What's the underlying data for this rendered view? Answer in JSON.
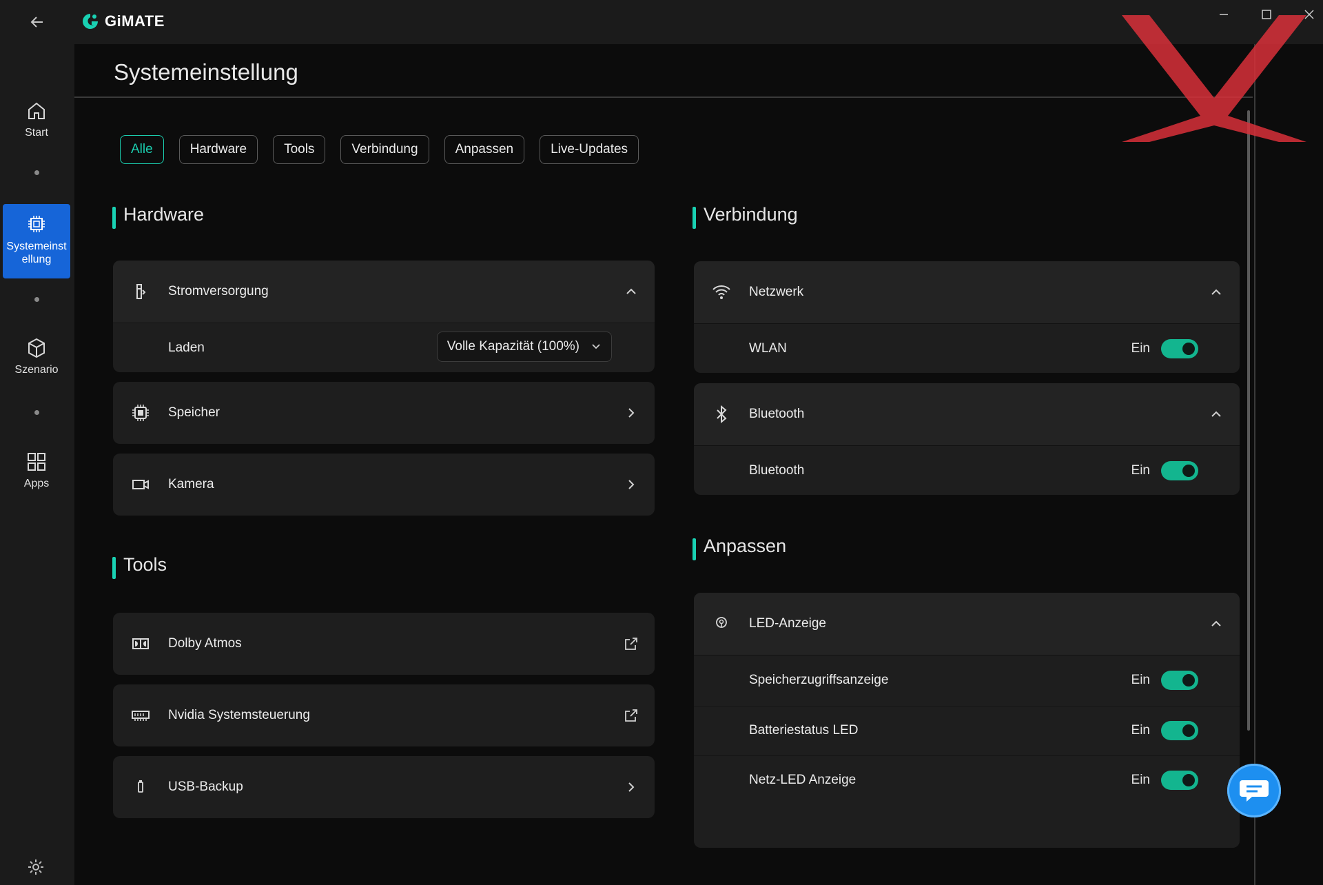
{
  "app": {
    "name": "GiMATE",
    "window_controls": [
      "minimize",
      "maximize",
      "close"
    ]
  },
  "colors": {
    "accent": "#19d1b3",
    "toggle_on": "#13b58f",
    "nav_active": "#1665d8",
    "watermark": "#e0303a"
  },
  "sidebar": {
    "items": [
      {
        "label": "Start",
        "icon": "home-icon"
      },
      {
        "label": "Systemeinst ellung",
        "icon": "chip-icon",
        "active": true
      },
      {
        "label": "Szenario",
        "icon": "cube-icon"
      },
      {
        "label": "Apps",
        "icon": "grid-icon"
      }
    ],
    "settings_icon": "gear-icon"
  },
  "page": {
    "title": "Systemeinstellung",
    "filters": [
      "Alle",
      "Hardware",
      "Tools",
      "Verbindung",
      "Anpassen",
      "Live-Updates"
    ],
    "active_filter": "Alle"
  },
  "hardware": {
    "title": "Hardware",
    "power": {
      "label": "Stromversorgung",
      "row_label": "Laden",
      "select_value": "Volle Kapazität (100%)"
    },
    "storage": {
      "label": "Speicher"
    },
    "camera": {
      "label": "Kamera"
    }
  },
  "tools": {
    "title": "Tools",
    "items": [
      {
        "label": "Dolby Atmos",
        "icon": "dolby-icon",
        "action": "external"
      },
      {
        "label": "Nvidia Systemsteuerung",
        "icon": "gpu-icon",
        "action": "external"
      },
      {
        "label": "USB-Backup",
        "icon": "usb-icon",
        "action": "chevron"
      }
    ]
  },
  "connection": {
    "title": "Verbindung",
    "network": {
      "label": "Netzwerk",
      "row_label": "WLAN",
      "state": "Ein"
    },
    "bluetooth": {
      "label": "Bluetooth",
      "row_label": "Bluetooth",
      "state": "Ein"
    }
  },
  "customize": {
    "title": "Anpassen",
    "led": {
      "label": "LED-Anzeige",
      "rows": [
        {
          "label": "Speicherzugriffsanzeige",
          "state": "Ein"
        },
        {
          "label": "Batteriestatus LED",
          "state": "Ein"
        },
        {
          "label": "Netz-LED Anzeige",
          "state": "Ein"
        }
      ]
    }
  }
}
